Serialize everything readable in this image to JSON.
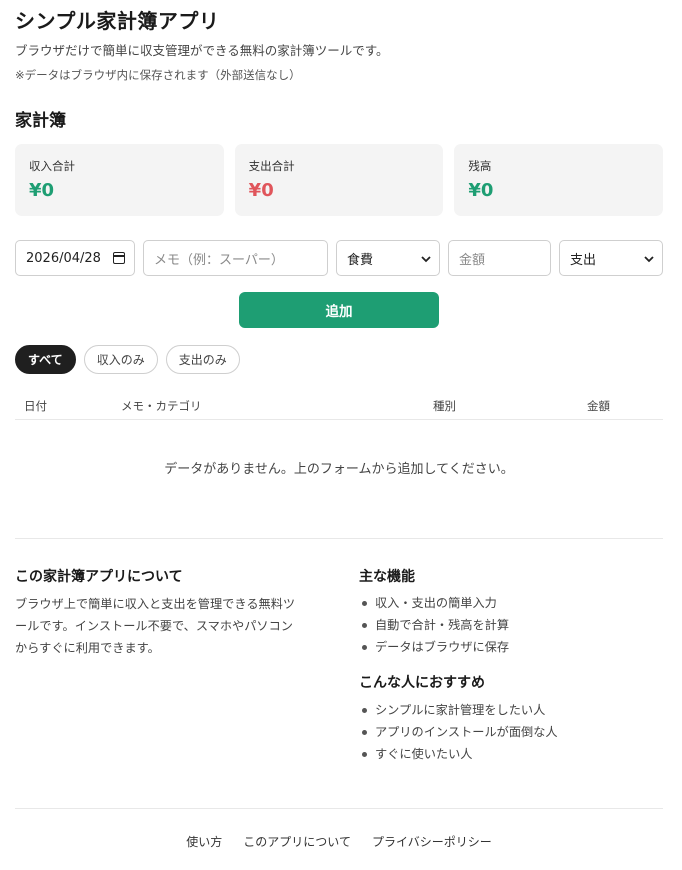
{
  "header": {
    "title": "シンプル家計簿アプリ",
    "description": "ブラウザだけで簡単に収支管理ができる無料の家計簿ツールです。",
    "note": "※データはブラウザ内に保存されます（外部送信なし）"
  },
  "section_title": "家計簿",
  "summary": {
    "income": {
      "label": "収入合計",
      "value": "¥0"
    },
    "expense": {
      "label": "支出合計",
      "value": "¥0"
    },
    "balance": {
      "label": "残高",
      "value": "¥0"
    }
  },
  "form": {
    "date_value": "2026/04/28",
    "memo_placeholder": "メモ（例：スーパー）",
    "category_selected": "食費",
    "amount_placeholder": "金額",
    "type_selected": "支出",
    "add_label": "追加"
  },
  "filters": {
    "all": "すべて",
    "income_only": "収入のみ",
    "expense_only": "支出のみ"
  },
  "table": {
    "headers": [
      "日付",
      "メモ・カテゴリ",
      "種別",
      "金額"
    ],
    "empty_message": "データがありません。上のフォームから追加してください。"
  },
  "about": {
    "title": "この家計簿アプリについて",
    "lines": [
      "ブラウザ上で簡単に収入と支出を管理できる無料ツ",
      "ールです。インストール不要で、スマホやパソコン",
      "からすぐに利用できます。"
    ]
  },
  "features": {
    "title": "主な機能",
    "items": [
      "収入・支出の簡単入力",
      "自動で合計・残高を計算",
      "データはブラウザに保存"
    ]
  },
  "recommend": {
    "title": "こんな人におすすめ",
    "items": [
      "シンプルに家計管理をしたい人",
      "アプリのインストールが面倒な人",
      "すぐに使いたい人"
    ]
  },
  "footer": {
    "links": [
      "使い方",
      "このアプリについて",
      "プライバシーポリシー"
    ]
  },
  "colors": {
    "accent": "#1e9e73",
    "expense": "#e0555b",
    "active_pill": "#1f1f1f"
  },
  "icons": {
    "date_picker": "calendar-icon",
    "select": "chevron-down-icon"
  }
}
